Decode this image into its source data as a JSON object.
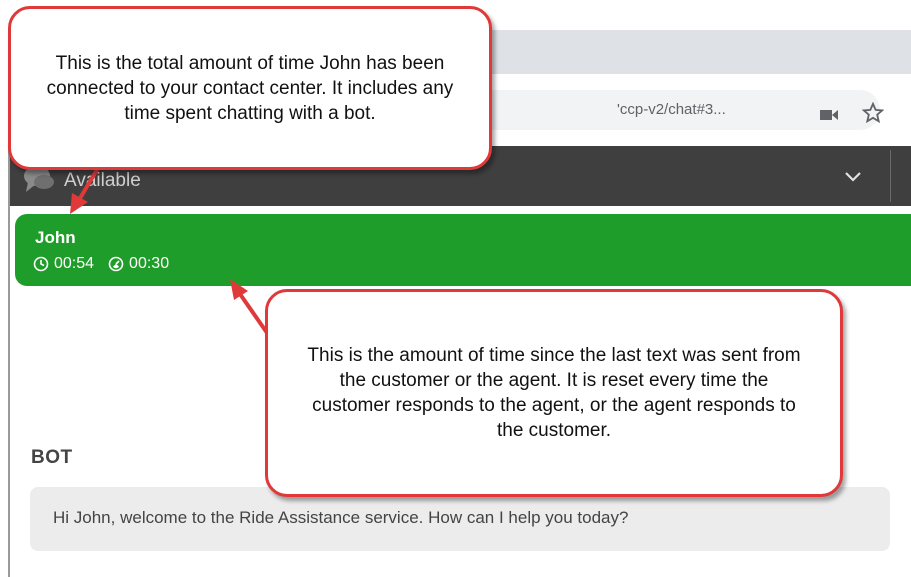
{
  "browser": {
    "url_fragment": "'ccp-v2/chat#3..."
  },
  "status_bar": {
    "status_text": "Available"
  },
  "contact": {
    "name": "John",
    "connected_time": "00:54",
    "since_last_message": "00:30",
    "card_color": "#1f9d2a"
  },
  "chat": {
    "sender_label": "BOT",
    "message": "Hi John, welcome to the Ride Assistance service. How can I help you today?"
  },
  "callouts": {
    "total_time": "This is the total amount of time John has been connected to your contact center. It includes any time spent chatting with a bot.",
    "last_text": "This is the amount of time since the last text was sent from the customer or the agent. It is reset every time the customer responds to the agent, or the agent responds to the customer.",
    "border_color": "#e0393a"
  }
}
